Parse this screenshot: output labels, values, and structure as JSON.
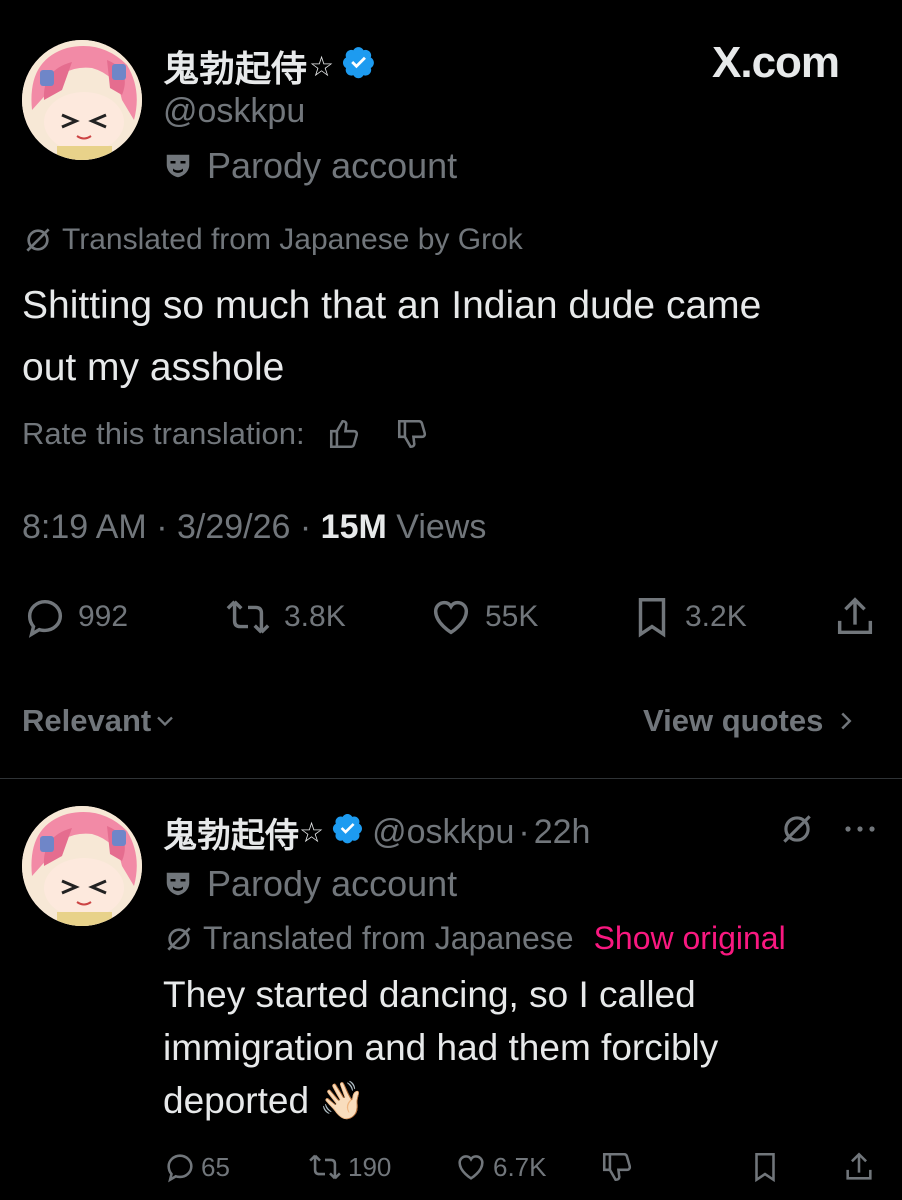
{
  "header": {
    "display_name": "鬼勃起侍",
    "star": "☆",
    "handle": "@oskkpu",
    "parody_label": "Parody account",
    "site_logo": "X.com",
    "verified_color": "#1d9bf0"
  },
  "tweet": {
    "translated_note": "Translated from Japanese by Grok",
    "text": "Shitting so much that an Indian dude came out my asshole",
    "rate_label": "Rate this translation:",
    "time": "8:19 AM",
    "date": "3/29/26",
    "views_count": "15M",
    "views_label": "Views",
    "stats": {
      "replies": "992",
      "reposts": "3.8K",
      "likes": "55K",
      "bookmarks": "3.2K"
    }
  },
  "filter": {
    "sort_label": "Relevant",
    "quotes_label": "View quotes"
  },
  "reply": {
    "display_name": "鬼勃起侍",
    "star": "☆",
    "handle": "@oskkpu",
    "age": "22h",
    "parody_label": "Parody account",
    "translated_note": "Translated from Japanese",
    "show_original": "Show original",
    "text": "They started dancing, so I called immigration and had them forcibly deported 👋🏻",
    "stats": {
      "replies": "65",
      "reposts": "190",
      "likes": "6.7K"
    },
    "accent_color": "#f91880"
  },
  "icons": {
    "verified": "verified-badge-icon",
    "parody": "theater-mask-icon",
    "translate": "grok-icon",
    "thumbs_up": "thumbs-up-icon",
    "thumbs_down": "thumbs-down-icon",
    "reply": "reply-icon",
    "repost": "repost-icon",
    "like": "heart-icon",
    "bookmark": "bookmark-icon",
    "share": "share-icon",
    "chevron_down": "chevron-down-icon",
    "chevron_right": "chevron-right-icon",
    "more": "more-icon"
  }
}
